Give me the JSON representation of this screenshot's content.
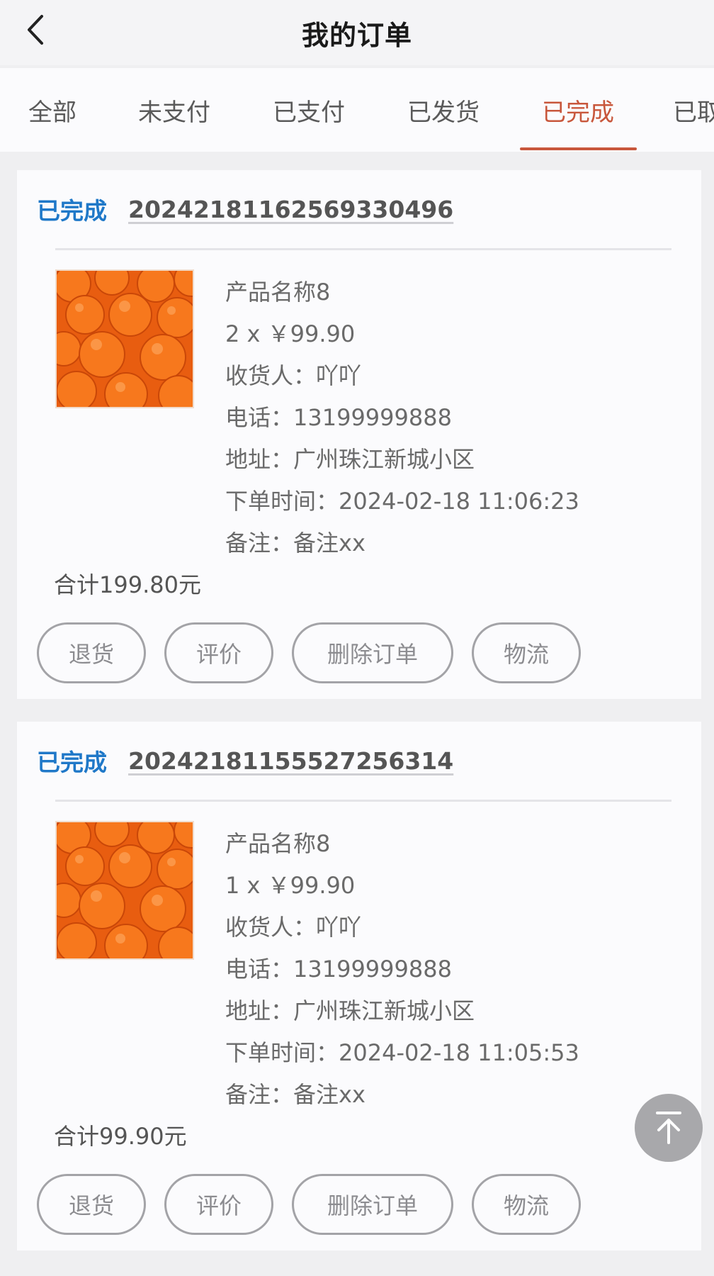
{
  "header": {
    "title": "我的订单",
    "back_icon": "chevron-left-icon"
  },
  "tabs": [
    {
      "label": "全部",
      "active": false
    },
    {
      "label": "未支付",
      "active": false
    },
    {
      "label": "已支付",
      "active": false
    },
    {
      "label": "已发货",
      "active": false
    },
    {
      "label": "已完成",
      "active": true
    },
    {
      "label": "已取",
      "active": false
    }
  ],
  "colors": {
    "accent": "#c8573c",
    "status_blue": "#1f78c8",
    "pill_border": "#a3a3a7"
  },
  "orders": [
    {
      "status": "已完成",
      "order_no": "20242181162569330496",
      "product_name": "产品名称8",
      "qty_price": "2 x ￥99.90",
      "receiver": "收货人：吖吖",
      "phone": "电话：13199999888",
      "address": "地址：广州珠江新城小区",
      "order_time": "下单时间：2024-02-18 11:06:23",
      "remark": "备注：备注xx",
      "total": "合计199.80元"
    },
    {
      "status": "已完成",
      "order_no": "20242181155527256314",
      "product_name": "产品名称8",
      "qty_price": "1 x ￥99.90",
      "receiver": "收货人：吖吖",
      "phone": "电话：13199999888",
      "address": "地址：广州珠江新城小区",
      "order_time": "下单时间：2024-02-18 11:05:53",
      "remark": "备注：备注xx",
      "total": "合计99.90元"
    }
  ],
  "actions": {
    "return": "退货",
    "review": "评价",
    "delete": "删除订单",
    "logistics": "物流"
  },
  "scroll_top_icon": "arrow-up-to-top-icon"
}
